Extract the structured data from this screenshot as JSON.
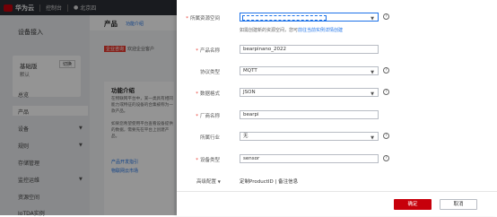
{
  "topbar": {
    "brand": "华为云",
    "console": "控制台",
    "region": "北京四"
  },
  "sidenav": {
    "title": "设备接入",
    "edition_name": "基础版",
    "edition_switch": "切换",
    "edition_sub": "默认",
    "items": [
      {
        "label": "总览"
      },
      {
        "label": "产品"
      },
      {
        "label": "设备"
      },
      {
        "label": "规则"
      },
      {
        "label": "存储管理"
      },
      {
        "label": "监控运维"
      },
      {
        "label": "资源空间"
      },
      {
        "label": "IoTDA实例"
      }
    ]
  },
  "main": {
    "tab_title": "产品",
    "tab_intro": "功能介绍",
    "banner_tag": "企业咨询",
    "banner_text": "欢迎企业客户",
    "panel_title": "功能介绍",
    "panel_p1": "在物联网平台中，某一类具有相同能力或特征的设备的合集被称为一款产品。",
    "panel_p2": "如果您希望使用平台查看设备提供的数据，需要先在平台上创建产品。",
    "link1": "产品开发指引",
    "link2": "物联网云市场"
  },
  "form": {
    "resource_space": {
      "label": "所属资源空间",
      "value": ""
    },
    "resource_hint_prefix": "如需创建新的资源空间，您可",
    "resource_hint_link": "前往当前实例详情创建",
    "product_name": {
      "label": "产品名称",
      "value": "bearpinano_2022"
    },
    "protocol": {
      "label": "协议类型",
      "value": "MQTT"
    },
    "data_format": {
      "label": "数据格式",
      "value": "JSON"
    },
    "vendor": {
      "label": "厂商名称",
      "value": "bearpi"
    },
    "industry": {
      "label": "所属行业",
      "value": "无"
    },
    "device_type": {
      "label": "设备类型",
      "value": "sensor"
    },
    "advanced": {
      "label": "高级配置",
      "desc": "定制ProductID | 备注信息"
    }
  },
  "footer": {
    "ok": "确定",
    "cancel": "取消"
  },
  "colors": {
    "accent": "#c7000b",
    "link": "#1d72e8",
    "topbar": "#2b2f36"
  }
}
